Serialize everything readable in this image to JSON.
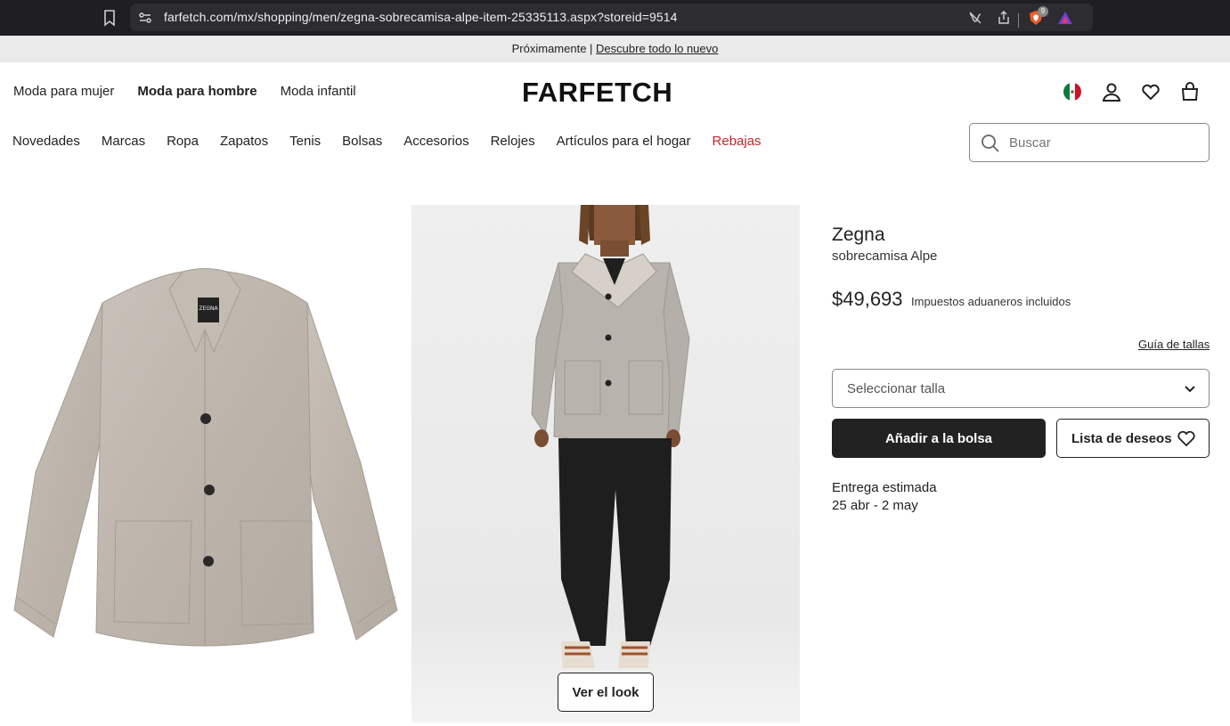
{
  "browser": {
    "url": "farfetch.com/mx/shopping/men/zegna-sobrecamisa-alpe-item-25335113.aspx?storeid=9514",
    "brave_badge_count": "9"
  },
  "announcement": {
    "text": "Próximamente | ",
    "link": "Descubre todo lo nuevo"
  },
  "header": {
    "logo": "FARFETCH",
    "gender_nav": [
      {
        "label": "Moda para mujer"
      },
      {
        "label": "Moda para hombre",
        "active": true
      },
      {
        "label": "Moda infantil"
      }
    ],
    "categories": [
      "Novedades",
      "Marcas",
      "Ropa",
      "Zapatos",
      "Tenis",
      "Bolsas",
      "Accesorios",
      "Relojes",
      "Artículos para el hogar",
      "Rebajas"
    ],
    "search_placeholder": "Buscar",
    "sale_color": "#c1272d"
  },
  "product": {
    "brand": "Zegna",
    "name": "sobrecamisa Alpe",
    "price": "$49,693",
    "price_note": "Impuestos aduaneros incluidos",
    "size_guide": "Guía de tallas",
    "size_select": "Seleccionar talla",
    "add_to_bag": "Añadir a la bolsa",
    "wishlist": "Lista de deseos",
    "delivery_label": "Entrega estimada",
    "delivery_dates": "25 abr - 2 may",
    "view_look": "Ver el look",
    "tag_text": "ZEGNA"
  }
}
